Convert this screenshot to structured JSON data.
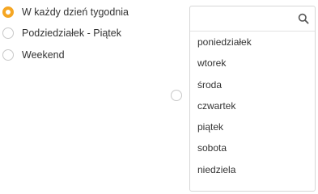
{
  "schedule": {
    "options": [
      {
        "label": "W każdy dzień tygodnia",
        "checked": true
      },
      {
        "label": "Podziedziałek - Piątek",
        "checked": false
      },
      {
        "label": "Weekend",
        "checked": false
      }
    ]
  },
  "custom_days_radio": {
    "checked": false
  },
  "day_picker": {
    "search_placeholder": "",
    "search_value": "",
    "days": [
      "poniedziałek",
      "wtorek",
      "środa",
      "czwartek",
      "piątek",
      "sobota",
      "niedziela"
    ]
  },
  "colors": {
    "accent": "#f5a623",
    "radio_border": "#c8c8c8",
    "text": "#333333"
  }
}
